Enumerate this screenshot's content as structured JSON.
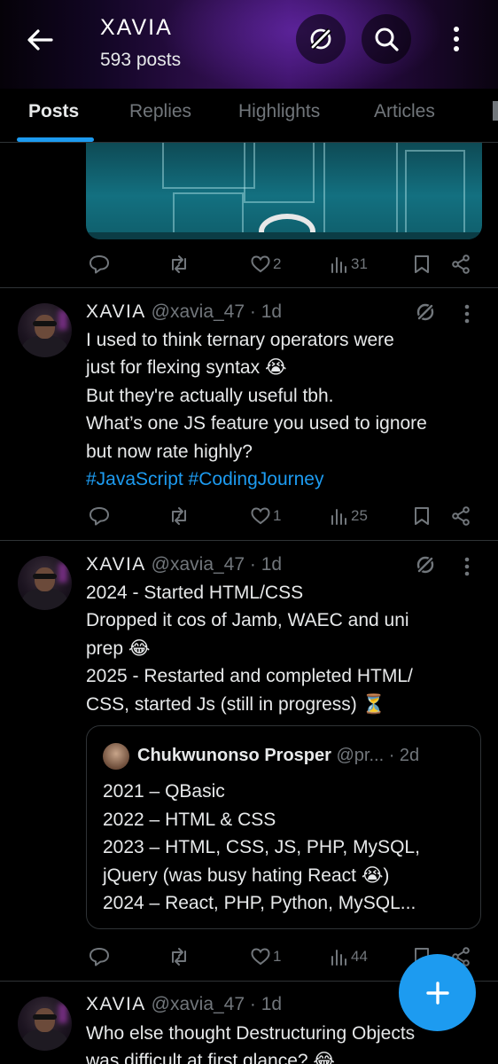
{
  "header": {
    "title": "XAVIA",
    "post_count": "593 posts",
    "back_icon": "arrow-left-icon",
    "grok_icon": "grok-icon",
    "search_icon": "search-icon",
    "more_icon": "more-vertical-icon"
  },
  "tabs": [
    {
      "label": "Posts",
      "active": true
    },
    {
      "label": "Replies",
      "active": false
    },
    {
      "label": "Highlights",
      "active": false
    },
    {
      "label": "Articles",
      "active": false
    }
  ],
  "prev_post_actions": {
    "likes": "2",
    "views": "31"
  },
  "posts": [
    {
      "name": "XAVIA",
      "handle": "@xavia_47 · 1d",
      "lines": [
        "I used to think ternary operators were",
        "just for flexing syntax",
        "But they're actually useful tbh.",
        "What’s one JS feature you used to ignore",
        "but now rate highly?"
      ],
      "emoji_line2": "😭",
      "hashtags": "#JavaScript #CodingJourney",
      "likes": "1",
      "views": "25"
    },
    {
      "name": "XAVIA",
      "handle": "@xavia_47 · 1d",
      "lines": [
        "2024 - Started HTML/CSS",
        "Dropped it cos of Jamb, WAEC and uni",
        "prep",
        "2025 - Restarted and completed HTML/",
        "CSS, started Js (still in progress)"
      ],
      "emoji_line3": "😂",
      "emoji_line5": "⏳",
      "quote": {
        "name": "Chukwunonso Prosper",
        "handle": "@pr...",
        "time": "· 2d",
        "lines": [
          "2021 – QBasic",
          "2022 – HTML & CSS",
          "2023 – HTML, CSS, JS, PHP, MySQL,",
          "jQuery (was busy hating React",
          "2024 – React, PHP, Python, MySQL..."
        ],
        "emoji_line4": "😭",
        "close_paren": ")"
      },
      "likes": "1",
      "views": "44"
    },
    {
      "name": "XAVIA",
      "handle": "@xavia_47 · 1d",
      "lines": [
        "Who else thought Destructuring Objects",
        "was difficult at first glance?"
      ],
      "emoji_line2": "😂"
    }
  ],
  "fab": {
    "icon": "plus-icon"
  },
  "colors": {
    "accent": "#1d9bf0",
    "muted": "#71767b",
    "text": "#e7e9ea",
    "divider": "#2f3336"
  }
}
